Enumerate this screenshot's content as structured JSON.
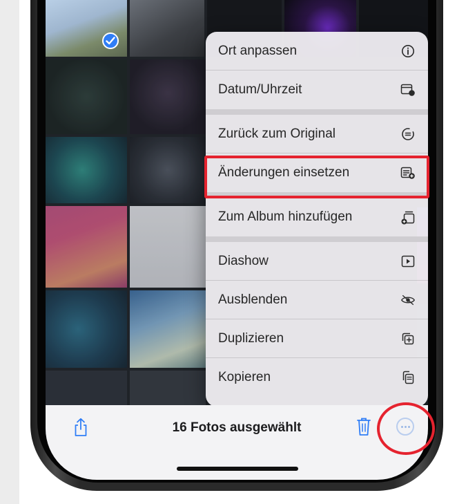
{
  "menu": {
    "items": [
      {
        "label": "Ort anpassen",
        "icon": "info-icon"
      },
      {
        "label": "Datum/Uhrzeit",
        "icon": "calendar-clock-icon"
      },
      {
        "label": "Zurück zum Original",
        "icon": "revert-icon"
      },
      {
        "label": "Änderungen einsetzen",
        "icon": "paste-edits-icon"
      },
      {
        "label": "Zum Album hinzufügen",
        "icon": "add-to-album-icon"
      },
      {
        "label": "Diashow",
        "icon": "play-icon"
      },
      {
        "label": "Ausblenden",
        "icon": "hide-eye-icon"
      },
      {
        "label": "Duplizieren",
        "icon": "duplicate-icon"
      },
      {
        "label": "Kopieren",
        "icon": "copy-icon"
      }
    ],
    "highlighted_item": "Änderungen einsetzen"
  },
  "toolbar": {
    "status": "16 Fotos ausgewählt",
    "share_icon": "share-icon",
    "trash_icon": "trash-icon",
    "more_icon": "more-ellipsis-icon"
  },
  "colors": {
    "accent": "#2f7df6",
    "annotation": "#e5232f",
    "menu_background": "#eeecf0"
  }
}
